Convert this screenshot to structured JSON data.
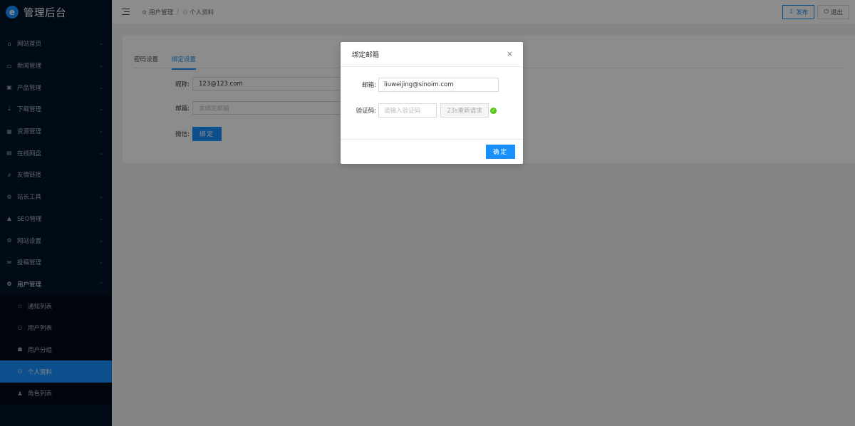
{
  "app": {
    "logo_letter": "e",
    "title": "管理后台"
  },
  "sidebar": {
    "items": [
      {
        "label": "网站首页",
        "icon": "home-icon",
        "glyph": "⌂",
        "arrow": "⌄"
      },
      {
        "label": "新闻管理",
        "icon": "news-icon",
        "glyph": "▭",
        "arrow": "⌄"
      },
      {
        "label": "产品管理",
        "icon": "product-icon",
        "glyph": "▣",
        "arrow": "⌄"
      },
      {
        "label": "下载管理",
        "icon": "download-icon",
        "glyph": "⤓",
        "arrow": "⌄"
      },
      {
        "label": "资源管理",
        "icon": "resource-icon",
        "glyph": "▦",
        "arrow": "⌄"
      },
      {
        "label": "在线网盘",
        "icon": "disk-icon",
        "glyph": "▤",
        "arrow": "⌄"
      },
      {
        "label": "友情链接",
        "icon": "link-icon",
        "glyph": "∂",
        "arrow": ""
      },
      {
        "label": "站长工具",
        "icon": "tools-icon",
        "glyph": "⚙",
        "arrow": "⌄"
      },
      {
        "label": "SEO管理",
        "icon": "warning-icon",
        "glyph": "▲",
        "arrow": "⌄"
      },
      {
        "label": "网站设置",
        "icon": "settings-icon",
        "glyph": "⚙",
        "arrow": "⌄"
      },
      {
        "label": "投稿管理",
        "icon": "mail-icon",
        "glyph": "✉",
        "arrow": "⌄"
      },
      {
        "label": "用户管理",
        "icon": "gear-icon",
        "glyph": "⚙",
        "arrow": "⌃"
      }
    ],
    "sub_items": [
      {
        "label": "通知列表",
        "icon": "star-icon",
        "glyph": "☆"
      },
      {
        "label": "用户列表",
        "icon": "user-icon",
        "glyph": "⚇"
      },
      {
        "label": "用户分组",
        "icon": "team-icon",
        "glyph": "☗"
      },
      {
        "label": "个人资料",
        "icon": "user-icon",
        "glyph": "⚇"
      },
      {
        "label": "角色列表",
        "icon": "role-icon",
        "glyph": "♟"
      }
    ]
  },
  "header": {
    "breadcrumb": [
      {
        "label": "用户管理",
        "glyph": "⚙"
      },
      {
        "label": "个人资料",
        "glyph": "⚇"
      }
    ],
    "separator": "/",
    "publish_glyph": "⇩",
    "publish_label": "发布",
    "logout_glyph": "⏻",
    "logout_label": "退出"
  },
  "tabs": [
    "密码设置",
    "绑定设置"
  ],
  "form": {
    "nickname_label": "昵称:",
    "nickname_value": "123@123.com",
    "email_label": "邮箱:",
    "email_placeholder": "未绑定邮箱",
    "wechat_label": "微信:",
    "bind_button": "绑定"
  },
  "modal": {
    "title": "绑定邮箱",
    "close_glyph": "×",
    "email_label": "邮箱:",
    "email_value": "liuweijing@sinoim.com",
    "code_label": "验证码:",
    "code_placeholder": "请输入验证码",
    "retry_label": "23s重新请求",
    "check_glyph": "✓",
    "ok_button": "确定"
  },
  "colors": {
    "primary": "#1890ff",
    "sidebar": "#001529",
    "success": "#52c41a"
  }
}
